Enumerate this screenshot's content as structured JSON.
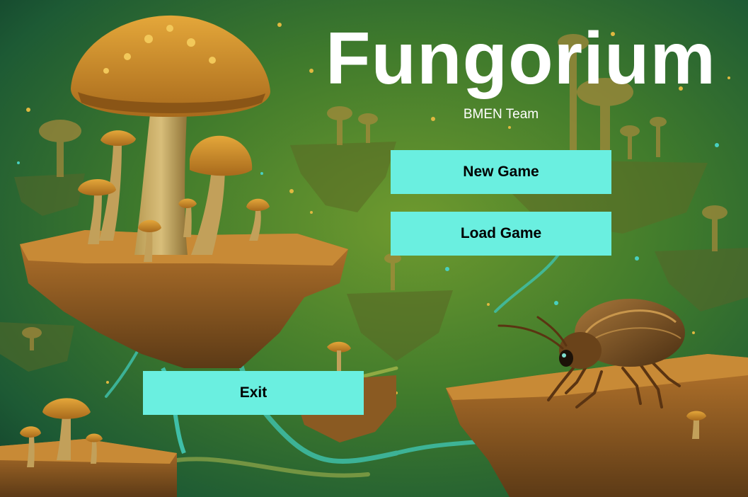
{
  "game": {
    "title": "Fungorium",
    "subtitle": "BMEN Team"
  },
  "menu": {
    "new_game_label": "New Game",
    "load_game_label": "Load Game",
    "exit_label": "Exit"
  },
  "colors": {
    "button_bg": "#6aefe0",
    "button_text": "#000000",
    "title_text": "#ffffff"
  },
  "scene": {
    "description_icon": "fungal-forest-background"
  }
}
